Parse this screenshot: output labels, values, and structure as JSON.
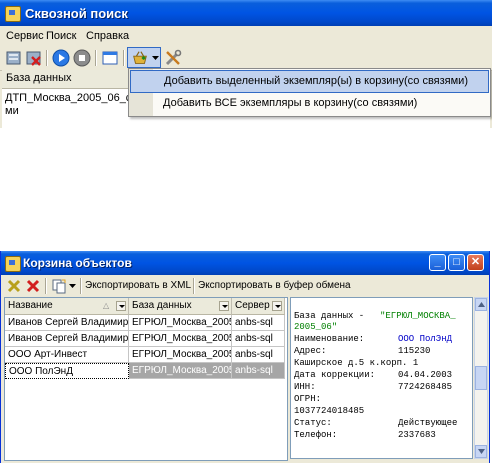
{
  "search_window": {
    "title": "Сквозной поиск",
    "menu": [
      "Сервис",
      "Поиск",
      "Справка"
    ],
    "grid": {
      "header": "База данных",
      "rows": [
        "ДТП_Москва_2005_06_с_",
        "ми"
      ]
    },
    "context_menu": {
      "items": [
        "Добавить выделенный экземпляр(ы) в корзину(со связями)",
        "Добавить ВСЕ экземпляры в корзину(со связями)"
      ]
    }
  },
  "basket_window": {
    "title": "Корзина объектов",
    "toolbar": {
      "export_xml": "Экспортировать в XML",
      "export_clipboard": "Экспортировать в буфер обмена"
    },
    "table": {
      "columns": [
        "Название",
        "База данных",
        "Сервер"
      ],
      "rows": [
        {
          "name": "Иванов Сергей Владимирс",
          "db": "ЕГРЮЛ_Москва_2005",
          "server": "anbs-sql"
        },
        {
          "name": "Иванов Сергей Владимирс",
          "db": "ЕГРЮЛ_Москва_2005",
          "server": "anbs-sql"
        },
        {
          "name": "ООО Арт-Инвест",
          "db": "ЕГРЮЛ_Москва_2005",
          "server": "anbs-sql"
        },
        {
          "name": "ООО ПолЭнД",
          "db": "ЕГРЮЛ_Москва_2005",
          "server": "anbs-sql"
        }
      ]
    },
    "detail": {
      "db_label": "База данных - ",
      "db_value_1": "\"ЕГРЮЛ_МОСКВА_",
      "db_value_2": "2005_06\"",
      "name_label": "Наименование:",
      "name_value": "ООО ПолЭнД",
      "address_label": "Адрес:",
      "address_value": "115230",
      "address_line": "Каширское д.5 к.корп. 1",
      "correction_label": "Дата коррекции:",
      "correction_value": "04.04.2003",
      "inn_label": "ИНН:",
      "inn_value": "7724268485",
      "ogrn_label": "ОГРН:",
      "ogrn_value": "1037724018485",
      "status_label": "Статус:",
      "status_value": "Действующее",
      "phone_label": "Телефон:",
      "phone_value": "2337683"
    }
  },
  "colors": {
    "title_bar": "#0054e3",
    "window_face": "#ece9d8",
    "menu_highlight": "#c1d2ee",
    "selected_row": "#a6a6a6",
    "detail_green": "#008000",
    "detail_blue": "#0000c8"
  }
}
